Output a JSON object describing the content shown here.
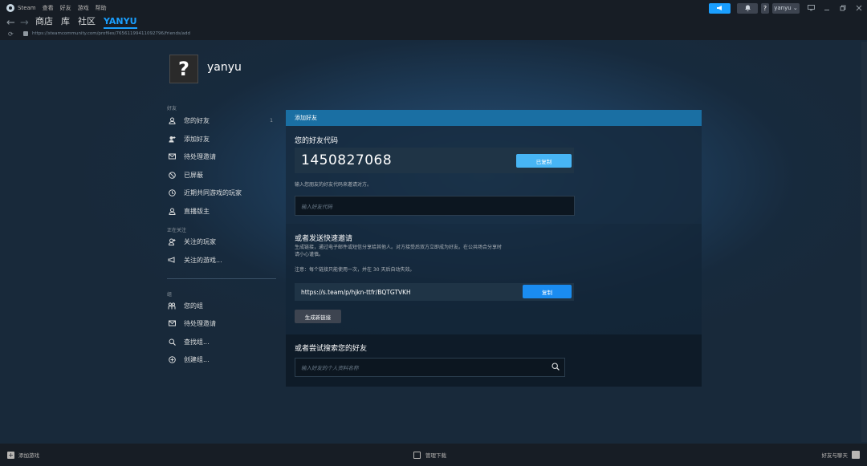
{
  "titlebar": {
    "app_name": "Steam",
    "menu": [
      "查看",
      "好友",
      "游戏",
      "帮助"
    ],
    "user_label": "yanyu ⌄",
    "help_label": "?"
  },
  "nav": {
    "links": [
      "商店",
      "库",
      "社区",
      "YANYU"
    ],
    "url": "https://steamcommunity.com/profiles/76561199411092796/friends/add"
  },
  "profile": {
    "avatar_glyph": "?",
    "name": "yanyu"
  },
  "sidebar": {
    "section_friends": "好友",
    "friends_items": [
      {
        "label": "您的好友",
        "count": "1"
      },
      {
        "label": "添加好友"
      },
      {
        "label": "待处理邀请"
      },
      {
        "label": "已屏蔽"
      },
      {
        "label": "近期共同游戏的玩家"
      },
      {
        "label": "直播版主"
      }
    ],
    "section_following": "正在关注",
    "following_items": [
      {
        "label": "关注的玩家"
      },
      {
        "label": "关注的游戏..."
      }
    ],
    "section_groups": "组",
    "group_items": [
      {
        "label": "您的组"
      },
      {
        "label": "待处理邀请"
      },
      {
        "label": "查找组..."
      },
      {
        "label": "创建组..."
      }
    ]
  },
  "panel": {
    "header": "添加好友",
    "friend_code_title": "您的好友代码",
    "friend_code": "1450827068",
    "copied_label": "已复制",
    "enter_code_hint": "输入您朋友的好友代码来邀请对方。",
    "code_input_placeholder": "输入好友代码",
    "quick_invite_title": "或者发送快速邀请",
    "quick_invite_desc_1": "生成链接，通过电子邮件或短信分享给其他人。对方接受后双方立即成为好友。在公共场合分享时",
    "quick_invite_desc_2": "请小心谨慎。",
    "quick_invite_note": "注意：每个链接只能使用一次，并在 30 天后自动失效。",
    "invite_link": "https://s.team/p/hjkn-ttfr/BQTGTVKH",
    "copy_label": "复制",
    "generate_label": "生成新链接",
    "search_title": "或者尝试搜索您的好友",
    "search_placeholder": "输入好友的个人资料名称"
  },
  "bottombar": {
    "add_game": "添加游戏",
    "manage_downloads": "管理下载",
    "friends_chat": "好友与聊天"
  },
  "colors": {
    "accent": "#1a9fff",
    "header_blue": "#1a6fa3",
    "copied_btn": "#47b5f5",
    "background": "#1b2838"
  }
}
